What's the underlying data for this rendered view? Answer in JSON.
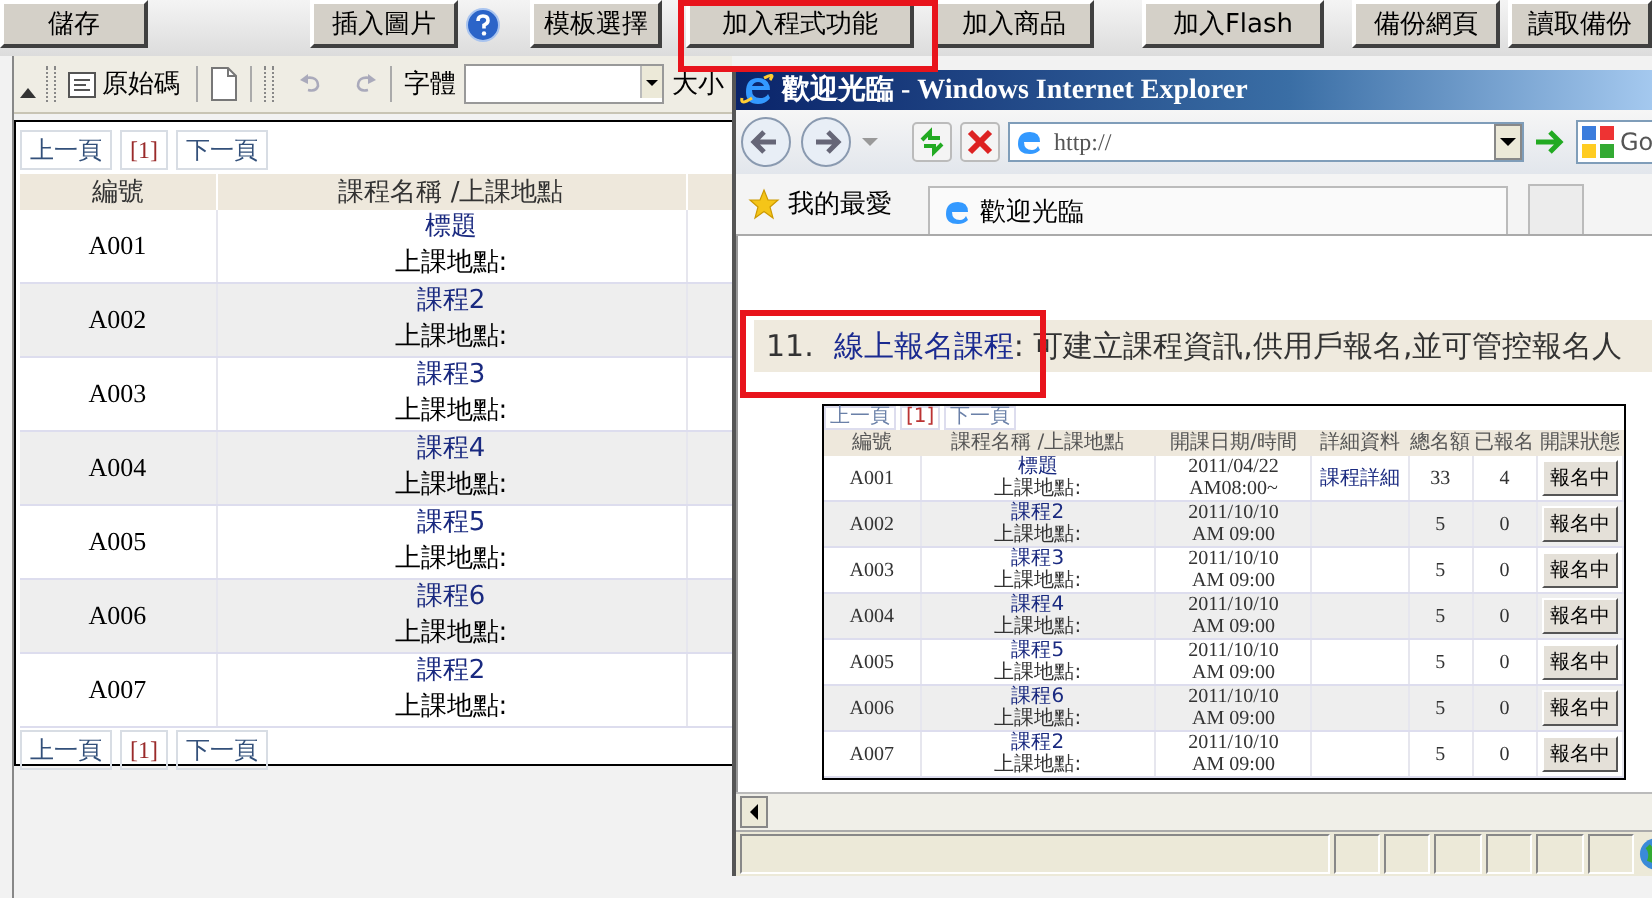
{
  "top_toolbar": {
    "items": [
      {
        "kind": "button",
        "label": "儲存"
      },
      {
        "kind": "button",
        "label": "插入圖片"
      },
      {
        "kind": "help"
      },
      {
        "kind": "button",
        "label": "模板選擇"
      },
      {
        "kind": "button",
        "label": "加入程式功能"
      },
      {
        "kind": "button",
        "label": "加入商品"
      },
      {
        "kind": "button",
        "label": "加入Flash"
      },
      {
        "kind": "button",
        "label": "備份網頁"
      },
      {
        "kind": "button",
        "label": "讀取備份"
      }
    ]
  },
  "editor": {
    "toolbar": {
      "source_button": "原始碼",
      "font_label": "字體",
      "size_label": "大小"
    },
    "pager_top": {
      "prev": "上一頁",
      "page": "[1]",
      "next": "下一頁"
    },
    "table": {
      "columns": [
        "編號",
        "課程名稱 /上課地點"
      ],
      "rows": [
        {
          "code": "A001",
          "title": "標題",
          "location": "上課地點:"
        },
        {
          "code": "A002",
          "title": "課程2",
          "location": "上課地點:"
        },
        {
          "code": "A003",
          "title": "課程3",
          "location": "上課地點:"
        },
        {
          "code": "A004",
          "title": "課程4",
          "location": "上課地點:"
        },
        {
          "code": "A005",
          "title": "課程5",
          "location": "上課地點:"
        },
        {
          "code": "A006",
          "title": "課程6",
          "location": "上課地點:"
        },
        {
          "code": "A007",
          "title": "課程2",
          "location": "上課地點:"
        }
      ]
    },
    "pager_bottom": {
      "prev": "上一頁",
      "page": "[1]",
      "next": "下一頁"
    }
  },
  "ie_window": {
    "title": "歡迎光臨 - Windows Internet Explorer",
    "address": "http://",
    "search_provider": "Go",
    "favorites_label": "我的最愛",
    "tab_title": "歡迎光臨",
    "feature": {
      "number": "11.",
      "link": "線上報名課程",
      "description": " : 可建立課程資訊,供用戶報名,並可管控報名人"
    },
    "preview": {
      "pager": {
        "prev": "上一頁",
        "page": "[1]",
        "next": "下一頁"
      },
      "columns": [
        "編號",
        "課程名稱 /上課地點",
        "開課日期/時間",
        "詳細資料",
        "總名額",
        "已報名",
        "開課狀態"
      ],
      "rows": [
        {
          "code": "A001",
          "title": "標題",
          "location": "上課地點:",
          "date": "2011/04/22",
          "time": "AM08:00~",
          "detail": "課程詳細",
          "quota": "33",
          "enrolled": "4",
          "status": "報名中"
        },
        {
          "code": "A002",
          "title": "課程2",
          "location": "上課地點:",
          "date": "2011/10/10",
          "time": "AM 09:00",
          "quota": "5",
          "enrolled": "0",
          "status": "報名中"
        },
        {
          "code": "A003",
          "title": "課程3",
          "location": "上課地點:",
          "date": "2011/10/10",
          "time": "AM 09:00",
          "quota": "5",
          "enrolled": "0",
          "status": "報名中"
        },
        {
          "code": "A004",
          "title": "課程4",
          "location": "上課地點:",
          "date": "2011/10/10",
          "time": "AM 09:00",
          "quota": "5",
          "enrolled": "0",
          "status": "報名中"
        },
        {
          "code": "A005",
          "title": "課程5",
          "location": "上課地點:",
          "date": "2011/10/10",
          "time": "AM 09:00",
          "quota": "5",
          "enrolled": "0",
          "status": "報名中"
        },
        {
          "code": "A006",
          "title": "課程6",
          "location": "上課地點:",
          "date": "2011/10/10",
          "time": "AM 09:00",
          "quota": "5",
          "enrolled": "0",
          "status": "報名中"
        },
        {
          "code": "A007",
          "title": "課程2",
          "location": "上課地點:",
          "date": "2011/10/10",
          "time": "AM 09:00",
          "quota": "5",
          "enrolled": "0",
          "status": "報名中"
        }
      ]
    }
  }
}
